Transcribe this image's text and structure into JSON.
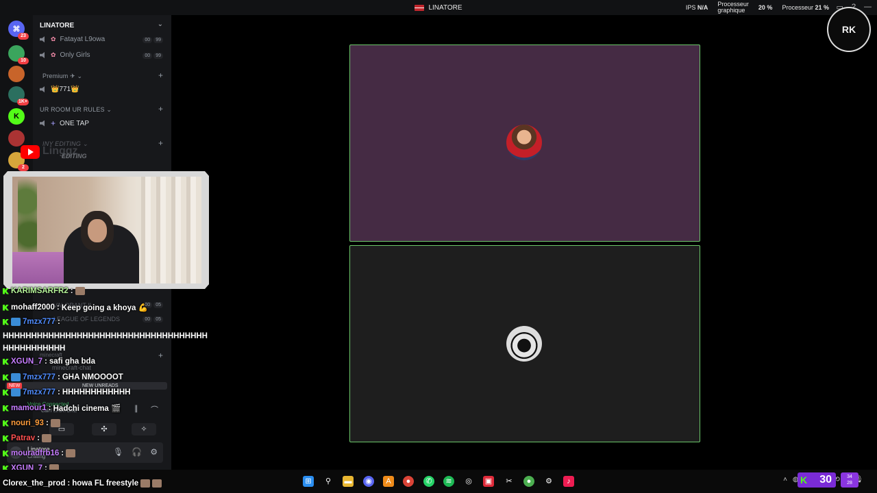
{
  "window": {
    "title": "LINATORE"
  },
  "stats": {
    "ips_label": "IPS",
    "ips_value": "N/A",
    "gpu_label_1": "Processeur",
    "gpu_label_2": "graphique",
    "gpu_value": "20 %",
    "cpu_label": "Processeur",
    "cpu_value": "21 %"
  },
  "guild_badges": [
    "23",
    "10",
    "1K+",
    "2"
  ],
  "sidebar": {
    "server_name": "LINATORE",
    "channels_top": [
      {
        "label": "Fatayat L9owa",
        "count_a": "00",
        "count_b": "99"
      },
      {
        "label": "Only Girls",
        "count_a": "00",
        "count_b": "99"
      }
    ],
    "premium_category": "Premium ✈ ⌄",
    "premium_channel": "👑771👑",
    "urroom_category": "UR ROOM UR RULES ⌄",
    "onetap_channel": "ONE TAP",
    "editing_category": "INY EDITING ⌄",
    "editing_channel": "EDITING",
    "valorant": "VALORANT II",
    "lol": "LEAGUE OF LEGENDS",
    "lol_counts": [
      "00",
      "05"
    ],
    "valorant_counts": [
      "00",
      "05"
    ],
    "minecraft_category": "minecraft",
    "minecraft_chat": "minecraft-chat",
    "voice_connected": "Voice Connected",
    "voice_channel": "Call / LINATORE",
    "user_name": "Linatore",
    "user_status": "Chilling"
  },
  "overlay": {
    "youtube_label": "Linggz"
  },
  "chat": [
    {
      "user": "KARIMSARFR2",
      "color": "#b6f59a",
      "text": ""
    },
    {
      "user": "mohaff2000",
      "color": "#ffffff",
      "text": "Keep going a khoya 💪"
    },
    {
      "user": "7mzx777",
      "color": "#4f8cff",
      "text": ""
    },
    {
      "user": "XGUN_7",
      "color": "#c77dff",
      "text": "safi gha bda"
    },
    {
      "user": "7mzx777",
      "color": "#4f8cff",
      "text": "GHA NMOOOOT"
    },
    {
      "user": "7mzx777",
      "color": "#4f8cff",
      "text": "HHHHHHHHHHHH"
    },
    {
      "user": "mamour1",
      "color": "#c77dff",
      "text": "Hadchi cinema 🎬"
    },
    {
      "user": "nouri_93",
      "color": "#ff9d3c",
      "text": ""
    },
    {
      "user": "Patrav",
      "color": "#ff5050",
      "text": ""
    },
    {
      "user": "mouradfrb16",
      "color": "#c77dff",
      "text": ""
    },
    {
      "user": "XGUN_7",
      "color": "#c77dff",
      "text": ""
    },
    {
      "user": "Clorex_the_prod",
      "color": "#ffffff",
      "text": "howa FL freestyle"
    }
  ],
  "chat_long": "HHHHHHHHHHHHHHHHHHHHHHHHHHHHHHHHHHHHHHHHHHHHHHH",
  "new_unreads": {
    "badge": "NEW",
    "text": "NEW UNREADS"
  },
  "taskbar": {
    "kick_count": "30",
    "kick_small_1": "34",
    "kick_small_2": "28"
  },
  "colors": {
    "tile_border": "#6cc76a",
    "tile1_bg": "#452b44",
    "tile2_bg": "#1e1e1e",
    "sidebar_bg": "#17181b"
  }
}
